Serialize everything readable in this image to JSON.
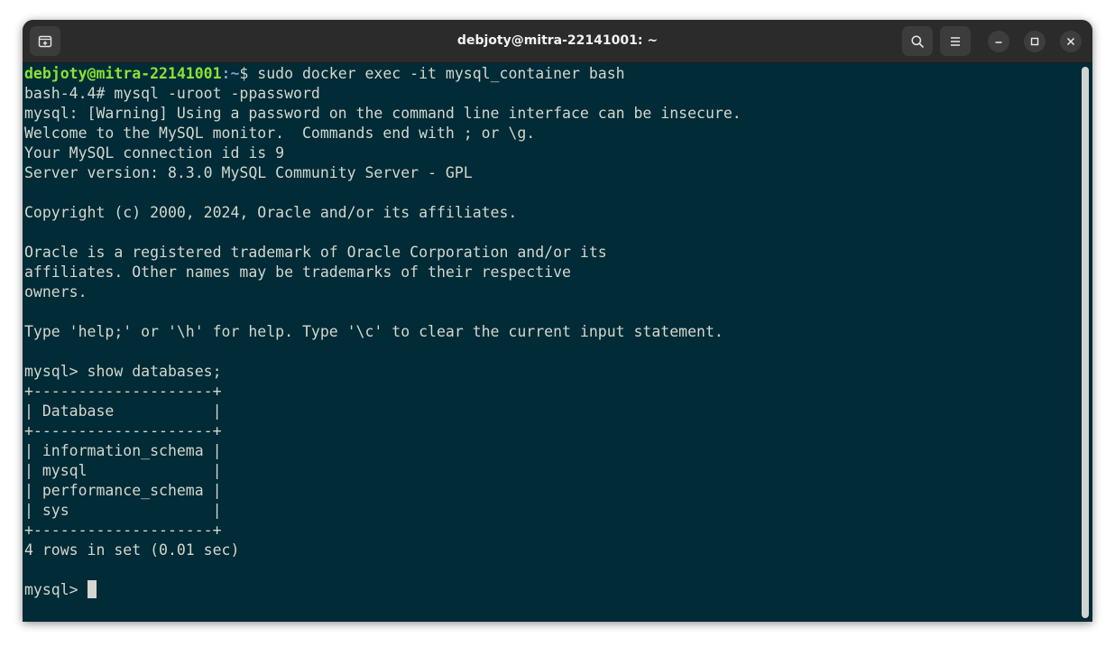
{
  "window": {
    "title": "debjoty@mitra-22141001: ~"
  },
  "prompt": {
    "user_host": "debjoty@mitra-22141001",
    "path": ":~",
    "symbol": "$ ",
    "command": "sudo docker exec -it mysql_container bash"
  },
  "terminal_lines": [
    "bash-4.4# mysql -uroot -ppassword",
    "mysql: [Warning] Using a password on the command line interface can be insecure.",
    "Welcome to the MySQL monitor.  Commands end with ; or \\g.",
    "Your MySQL connection id is 9",
    "Server version: 8.3.0 MySQL Community Server - GPL",
    "",
    "Copyright (c) 2000, 2024, Oracle and/or its affiliates.",
    "",
    "Oracle is a registered trademark of Oracle Corporation and/or its",
    "affiliates. Other names may be trademarks of their respective",
    "owners.",
    "",
    "Type 'help;' or '\\h' for help. Type '\\c' to clear the current input statement.",
    "",
    "mysql> show databases;",
    "+--------------------+",
    "| Database           |",
    "+--------------------+",
    "| information_schema |",
    "| mysql              |",
    "| performance_schema |",
    "| sys                |",
    "+--------------------+",
    "4 rows in set (0.01 sec)",
    ""
  ],
  "current_prompt": "mysql> ",
  "icons": {
    "new_tab": "new-tab-icon",
    "search": "search-icon",
    "menu": "hamburger-menu-icon",
    "minimize": "minimize-icon",
    "maximize": "maximize-icon",
    "close": "close-icon"
  },
  "colors": {
    "background": "#012b36",
    "foreground": "#d3d7cf",
    "user_host": "#8ae234",
    "path": "#729fcf",
    "titlebar": "#2b2b2b"
  }
}
